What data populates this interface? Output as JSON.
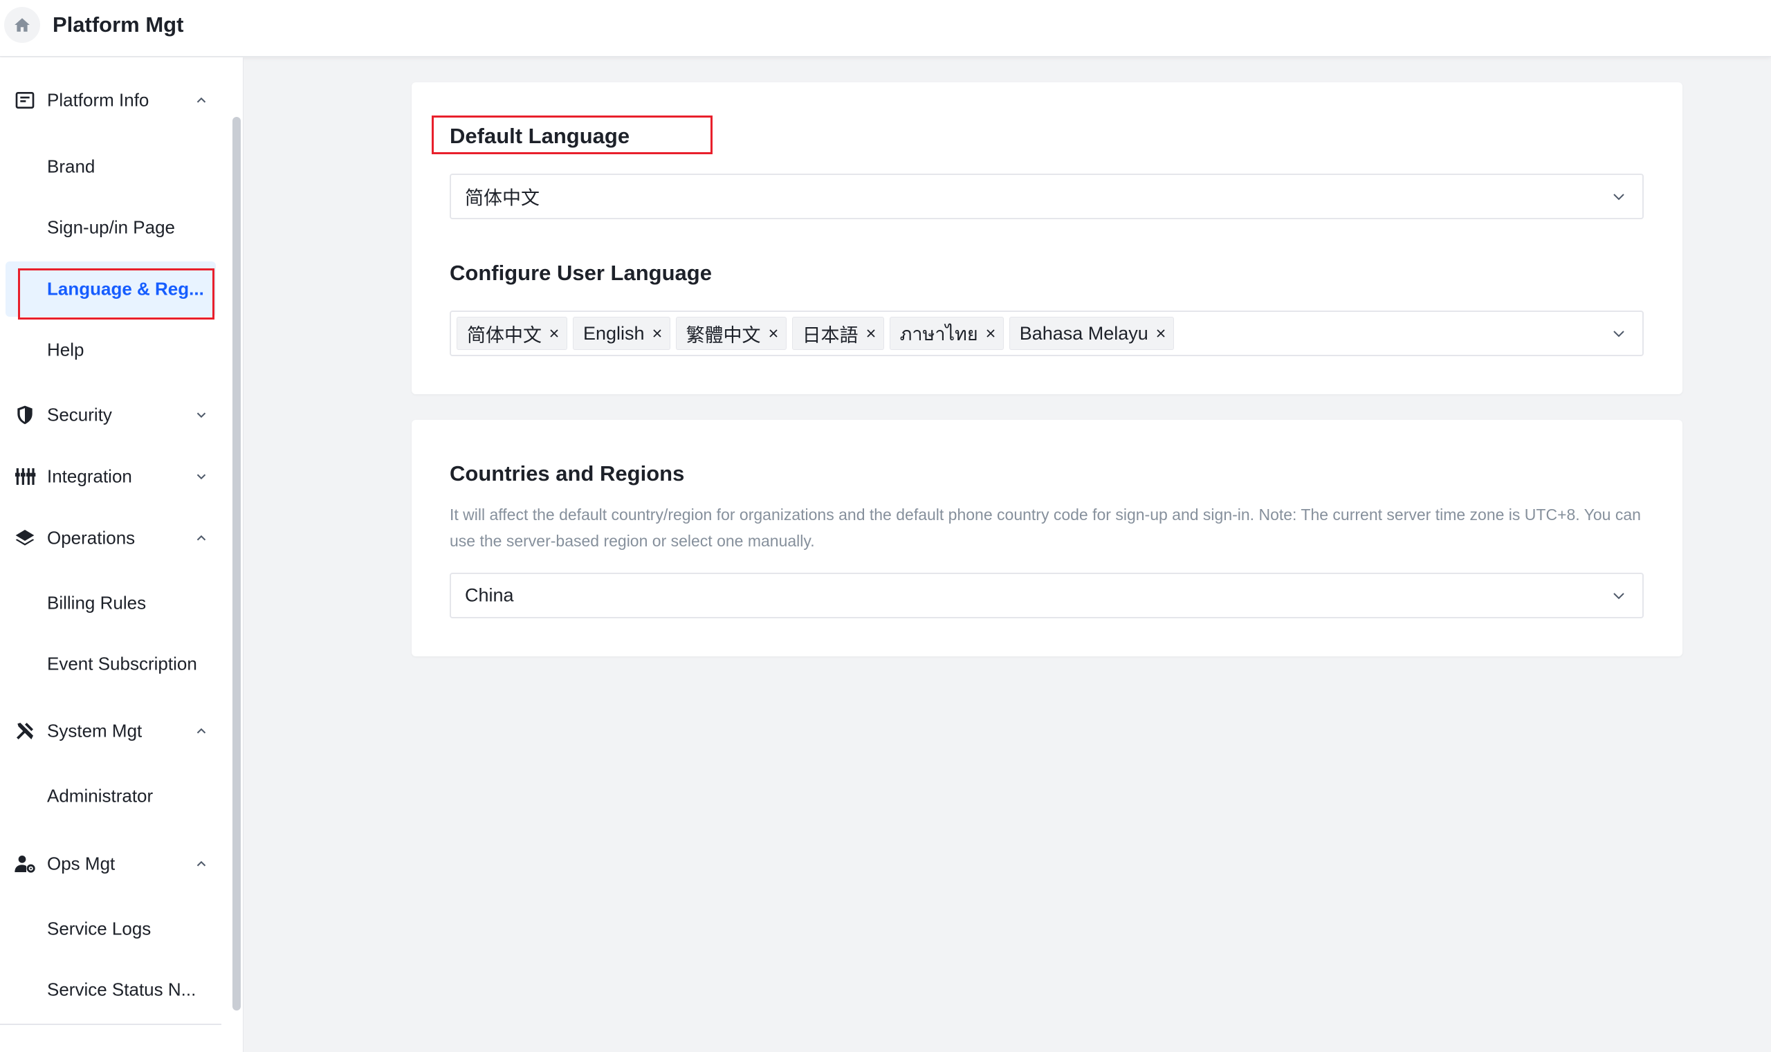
{
  "header": {
    "title": "Platform Mgt",
    "home_icon": "home-icon"
  },
  "sidebar": {
    "groups": {
      "platform_info": {
        "label": "Platform Info",
        "icon": "form-icon",
        "expanded": true
      },
      "security": {
        "label": "Security",
        "icon": "shield-icon",
        "expanded": false
      },
      "integration": {
        "label": "Integration",
        "icon": "sliders-icon",
        "expanded": false
      },
      "operations": {
        "label": "Operations",
        "icon": "layers-icon",
        "expanded": true
      },
      "system_mgt": {
        "label": "System Mgt",
        "icon": "tools-icon",
        "expanded": true
      },
      "ops_mgt": {
        "label": "Ops Mgt",
        "icon": "user-gear-icon",
        "expanded": true
      }
    },
    "items": {
      "brand": "Brand",
      "signup": "Sign-up/in Page",
      "language": "Language & Reg...",
      "help": "Help",
      "billing": "Billing Rules",
      "event_sub": "Event Subscription",
      "administrator": "Administrator",
      "service_logs": "Service Logs",
      "service_status": "Service Status N..."
    },
    "active_item": "language"
  },
  "language_card": {
    "default_title": "Default Language",
    "default_value": "简体中文",
    "configure_title": "Configure User Language",
    "tags": [
      "简体中文",
      "English",
      "繁體中文",
      "日本語",
      "ภาษาไทย",
      "Bahasa Melayu"
    ]
  },
  "region_card": {
    "title": "Countries and Regions",
    "description": "It will affect the default country/region for organizations and the default phone country code for sign-up and sign-in. Note: The current server time zone is UTC+8. You can use the server-based region or select one manually.",
    "value": "China"
  },
  "colors": {
    "accent": "#165dff",
    "active_bg": "#e8f3ff",
    "highlight_box": "#e8202c",
    "page_bg": "#f2f3f5"
  }
}
